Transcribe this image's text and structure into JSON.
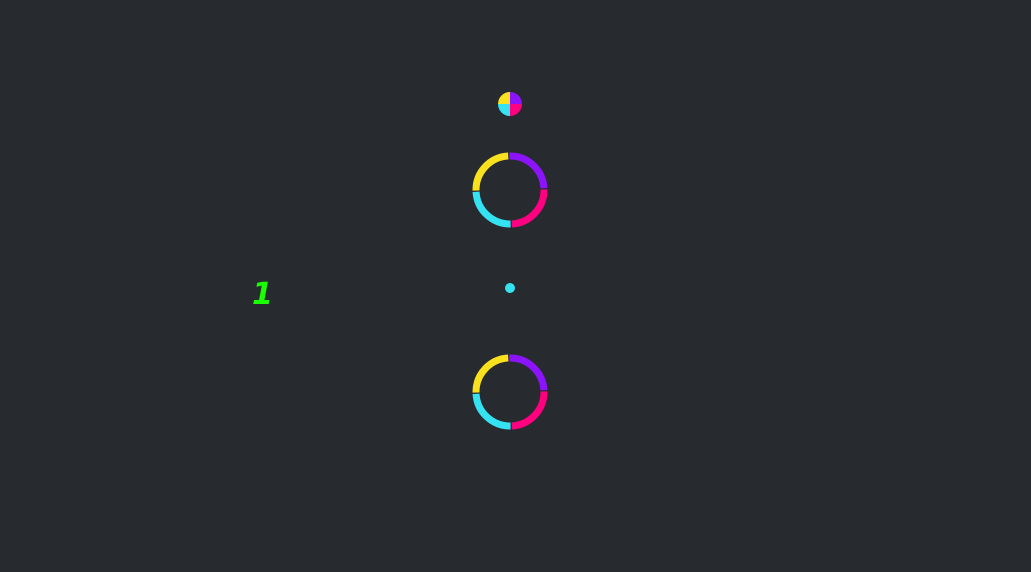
{
  "game": {
    "score": "1"
  },
  "colors": {
    "background": "#272a2f",
    "score": "#1aff00",
    "yellow": "#f9e11e",
    "purple": "#8c14fc",
    "magenta": "#ff0080",
    "cyan": "#35e2f2",
    "player": "#35e2f2"
  },
  "obstacles": [
    {
      "name": "ring-obstacle-top",
      "segments": [
        {
          "color": "purple"
        },
        {
          "color": "magenta"
        },
        {
          "color": "cyan"
        },
        {
          "color": "yellow"
        }
      ]
    },
    {
      "name": "ring-obstacle-bottom",
      "segments": [
        {
          "color": "purple"
        },
        {
          "color": "magenta"
        },
        {
          "color": "cyan"
        },
        {
          "color": "yellow"
        }
      ]
    }
  ],
  "color_switcher": {
    "quadrants": [
      {
        "color": "purple"
      },
      {
        "color": "magenta"
      },
      {
        "color": "cyan"
      },
      {
        "color": "yellow"
      }
    ]
  },
  "player": {
    "color": "cyan"
  }
}
